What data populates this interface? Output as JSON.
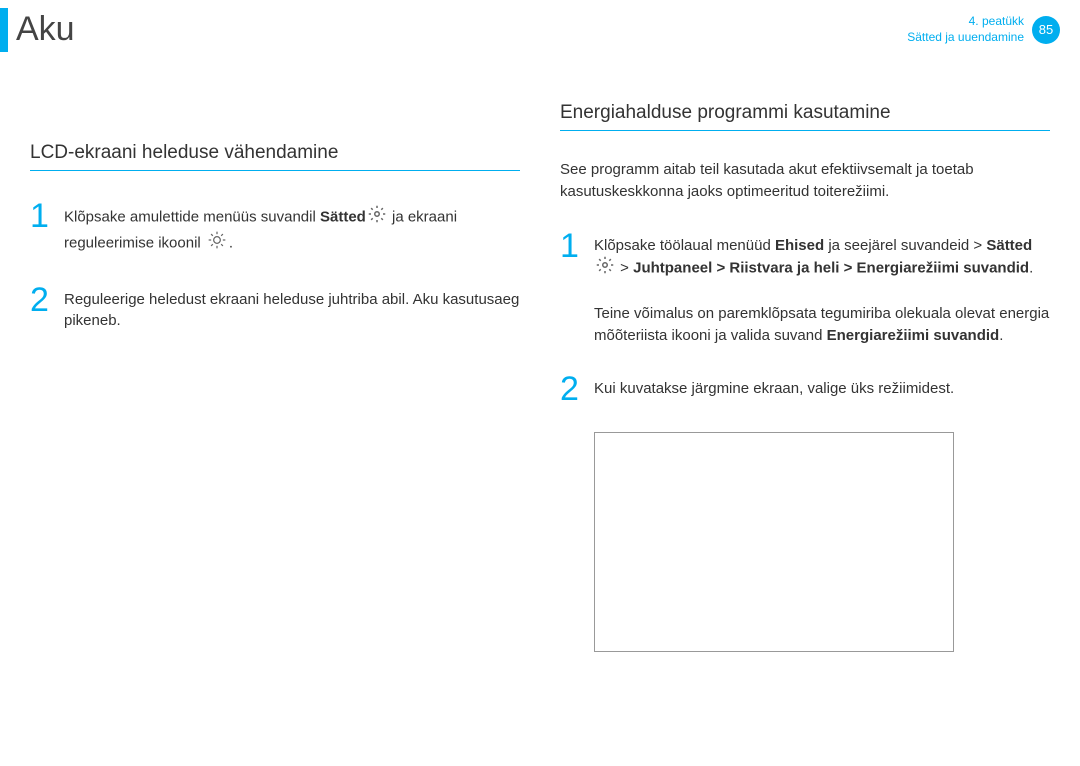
{
  "header": {
    "title": "Aku",
    "chapter_label": "4. peatükk",
    "chapter_name": "Sätted ja uuendamine",
    "page_number": "85"
  },
  "left": {
    "heading": "LCD-ekraani heleduse vähendamine",
    "step1_pre": "Klõpsake amulettide menüüs suvandil ",
    "step1_bold1": "Sätted",
    "step1_mid": " ja ekraani reguleerimise ikoonil ",
    "step1_post": ".",
    "step2": "Reguleerige heledust ekraani heleduse juhtriba abil. Aku kasutusaeg pikeneb."
  },
  "right": {
    "heading": "Energiahalduse programmi kasutamine",
    "intro": "See programm aitab teil kasutada akut efektiivsemalt ja toetab kasutuskeskkonna jaoks optimeeritud toiterežiimi.",
    "step1_pre": "Klõpsake töölaual menüüd ",
    "step1_bold1": "Ehised",
    "step1_mid1": " ja seejärel suvandeid > ",
    "step1_bold2": "Sätted",
    "step1_mid2": " > ",
    "step1_bold3": "Juhtpaneel > Riistvara ja heli > Energiarežiimi suvandid",
    "step1_post1": ".",
    "step1_para2_pre": "Teine võimalus on paremklõpsata tegumiriba olekuala olevat energia mõõteriista ikooni ",
    "step1_para2_mid": " ja valida suvand ",
    "step1_para2_bold": "Energiarežiimi suvandid",
    "step1_para2_post": ".",
    "step2": "Kui kuvatakse järgmine ekraan, valige üks režiimidest."
  }
}
